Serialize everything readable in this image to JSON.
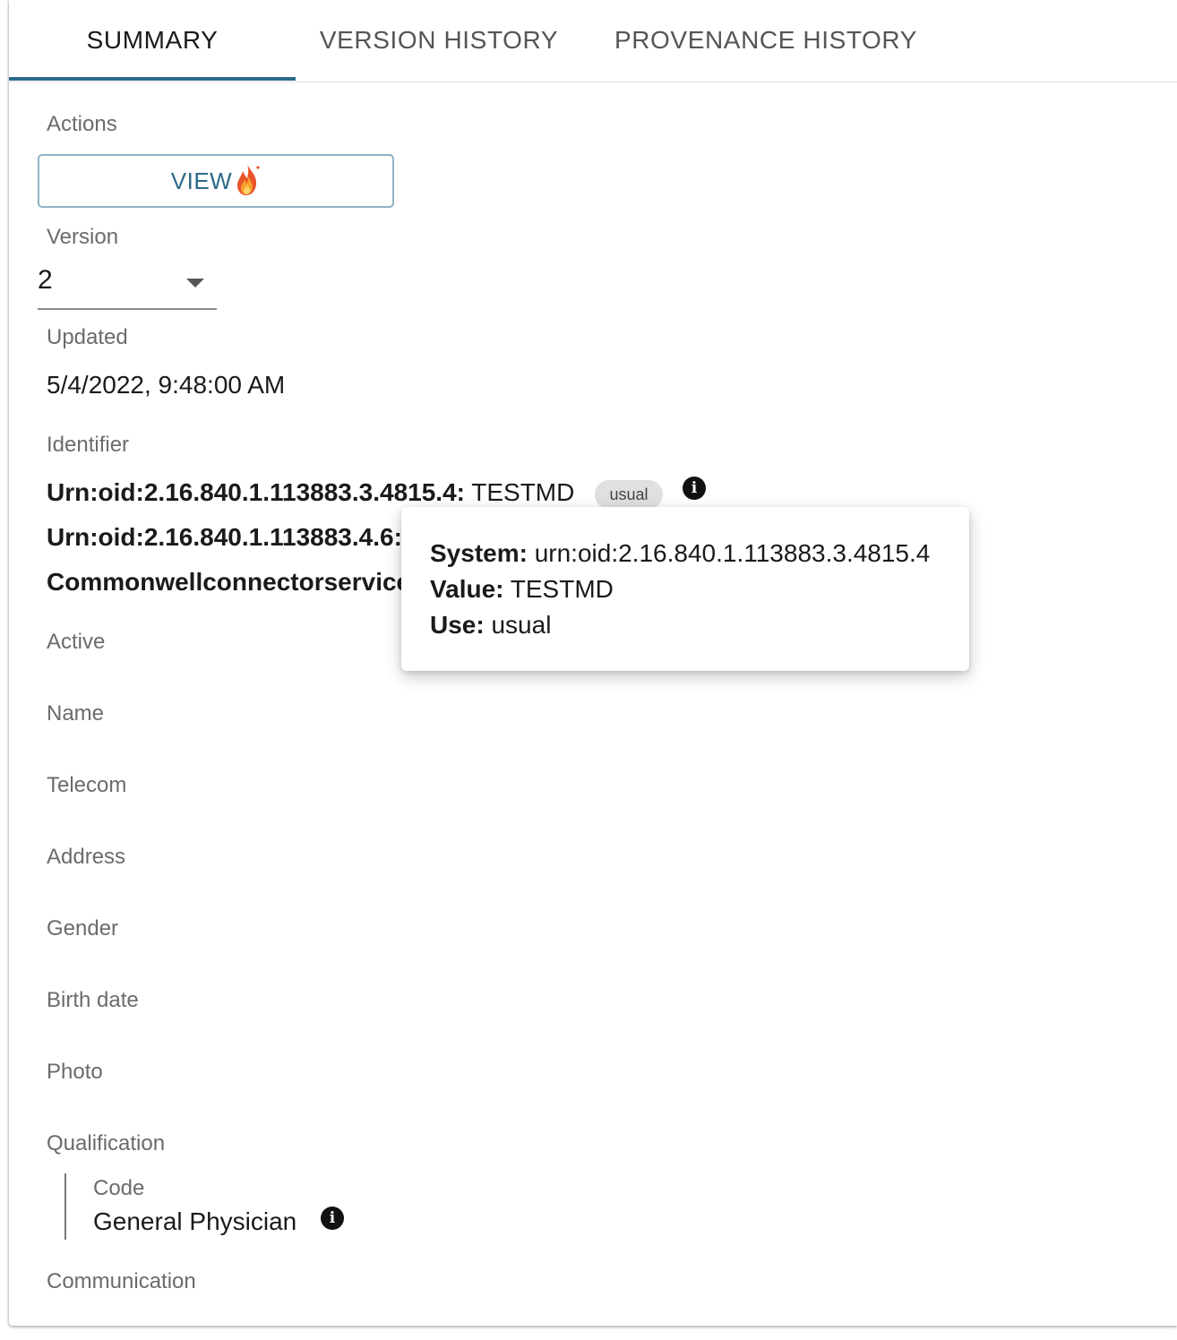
{
  "tabs": [
    {
      "label": "SUMMARY",
      "active": true
    },
    {
      "label": "VERSION HISTORY",
      "active": false
    },
    {
      "label": "PROVENANCE HISTORY",
      "active": false
    }
  ],
  "actions": {
    "label": "Actions",
    "view_label": "VIEW",
    "view_icon": "fhir-flame-icon"
  },
  "version": {
    "label": "Version",
    "value": "2"
  },
  "updated": {
    "label": "Updated",
    "value": "5/4/2022, 9:48:00 AM"
  },
  "identifier": {
    "label": "Identifier",
    "rows": [
      {
        "system": "Urn:oid:2.16.840.1.113883.3.4815.4:",
        "value": " TESTMD",
        "use": "usual"
      },
      {
        "system": "Urn:oid:2.16.840.1.113883.4.6:"
      },
      {
        "system": "Commonwellconnectorservice"
      }
    ],
    "tooltip": {
      "system_label": "System:",
      "system_value": " urn:oid:2.16.840.1.113883.3.4815.4",
      "value_label": "Value:",
      "value_value": " TESTMD",
      "use_label": "Use:",
      "use_value": " usual"
    }
  },
  "fields": {
    "active": "Active",
    "name": "Name",
    "telecom": "Telecom",
    "address": "Address",
    "gender": "Gender",
    "birth_date": "Birth date",
    "photo": "Photo",
    "qualification": "Qualification",
    "communication": "Communication"
  },
  "qualification": {
    "code_label": "Code",
    "code_value": "General Physician"
  },
  "colors": {
    "accent": "#2b6a8a",
    "button_border": "#8fb2c3"
  }
}
